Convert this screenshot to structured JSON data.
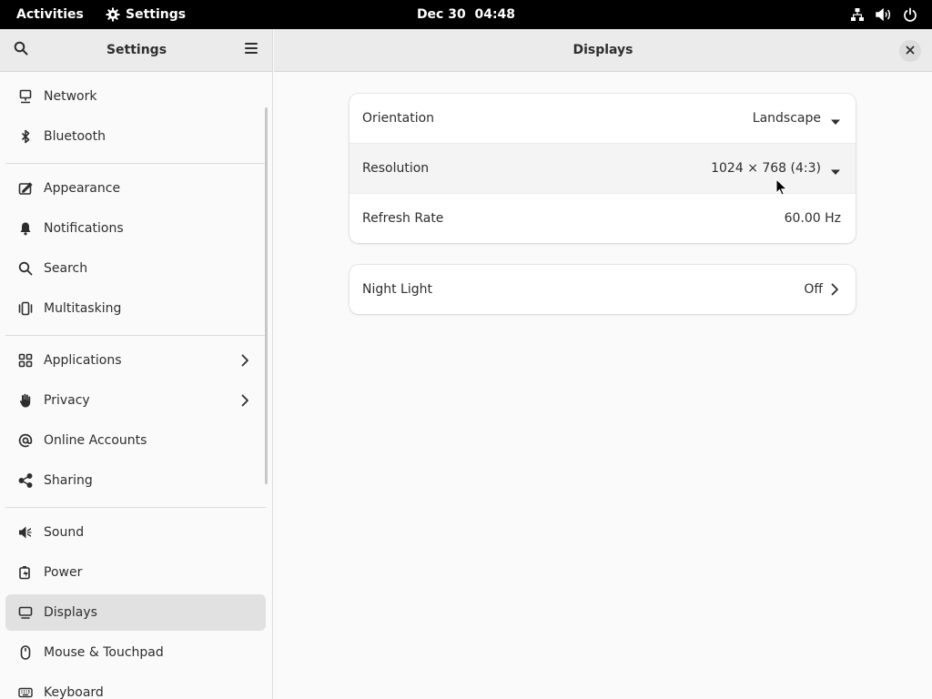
{
  "topbar": {
    "activities": "Activities",
    "app_name": "Settings",
    "date": "Dec 30",
    "time": "04:48",
    "tray_icons": [
      "network-icon",
      "volume-icon",
      "power-icon"
    ]
  },
  "sidebar": {
    "title": "Settings",
    "search_icon": "search-icon",
    "menu_icon": "hamburger-menu-icon",
    "groups": [
      [
        {
          "label": "Network",
          "icon": "network-wired-icon"
        },
        {
          "label": "Bluetooth",
          "icon": "bluetooth-icon"
        }
      ],
      [
        {
          "label": "Appearance",
          "icon": "appearance-icon"
        },
        {
          "label": "Notifications",
          "icon": "bell-icon"
        },
        {
          "label": "Search",
          "icon": "search-icon"
        },
        {
          "label": "Multitasking",
          "icon": "multitasking-icon"
        }
      ],
      [
        {
          "label": "Applications",
          "icon": "apps-grid-icon",
          "has_chevron": true
        },
        {
          "label": "Privacy",
          "icon": "hand-icon",
          "has_chevron": true
        },
        {
          "label": "Online Accounts",
          "icon": "at-sign-icon"
        },
        {
          "label": "Sharing",
          "icon": "share-icon"
        }
      ],
      [
        {
          "label": "Sound",
          "icon": "speaker-icon"
        },
        {
          "label": "Power",
          "icon": "battery-icon"
        },
        {
          "label": "Displays",
          "icon": "display-icon",
          "selected": true
        },
        {
          "label": "Mouse & Touchpad",
          "icon": "mouse-icon"
        },
        {
          "label": "Keyboard",
          "icon": "keyboard-icon"
        }
      ]
    ]
  },
  "main": {
    "title": "Displays",
    "close_icon": "close-icon",
    "display_card": {
      "orientation": {
        "label": "Orientation",
        "value": "Landscape"
      },
      "resolution": {
        "label": "Resolution",
        "value": "1024 × 768 (4:3)"
      },
      "refresh_rate": {
        "label": "Refresh Rate",
        "value": "60.00 Hz"
      }
    },
    "night_light": {
      "label": "Night Light",
      "value": "Off"
    }
  },
  "colors": {
    "topbar_bg": "#000000",
    "header_bg": "#ebebeb",
    "selected_bg": "#e1e1e1",
    "text": "#2e2e2e",
    "card_bg": "#ffffff"
  }
}
